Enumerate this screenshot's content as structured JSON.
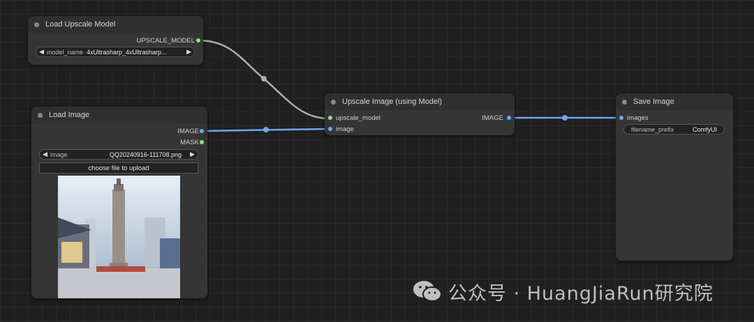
{
  "nodes": {
    "load_upscale_model": {
      "title": "Load Upscale Model",
      "output": "UPSCALE_MODEL",
      "widget": {
        "label": "model_name",
        "value": "4xUltrasharp_4xUltrasharp..."
      }
    },
    "load_image": {
      "title": "Load Image",
      "outputs": [
        "IMAGE",
        "MASK"
      ],
      "widget": {
        "label": "image",
        "value": "QQ20240916-111708.png"
      },
      "upload_label": "choose file to upload"
    },
    "upscale_image": {
      "title": "Upscale Image (using Model)",
      "inputs": [
        "upscale_model",
        "image"
      ],
      "output": "IMAGE"
    },
    "save_image": {
      "title": "Save Image",
      "input": "images",
      "widget": {
        "label": "filename_prefix",
        "value": "ComfyUI"
      }
    }
  },
  "watermark": "公众号 · HuangJiaRun研究院",
  "colors": {
    "canvas": "#202020",
    "node": "#353535",
    "model_link": "#a7b2a5",
    "image_link": "#6fa8f0",
    "model_dot": "#86e680",
    "image_dot": "#6fa8f0"
  }
}
